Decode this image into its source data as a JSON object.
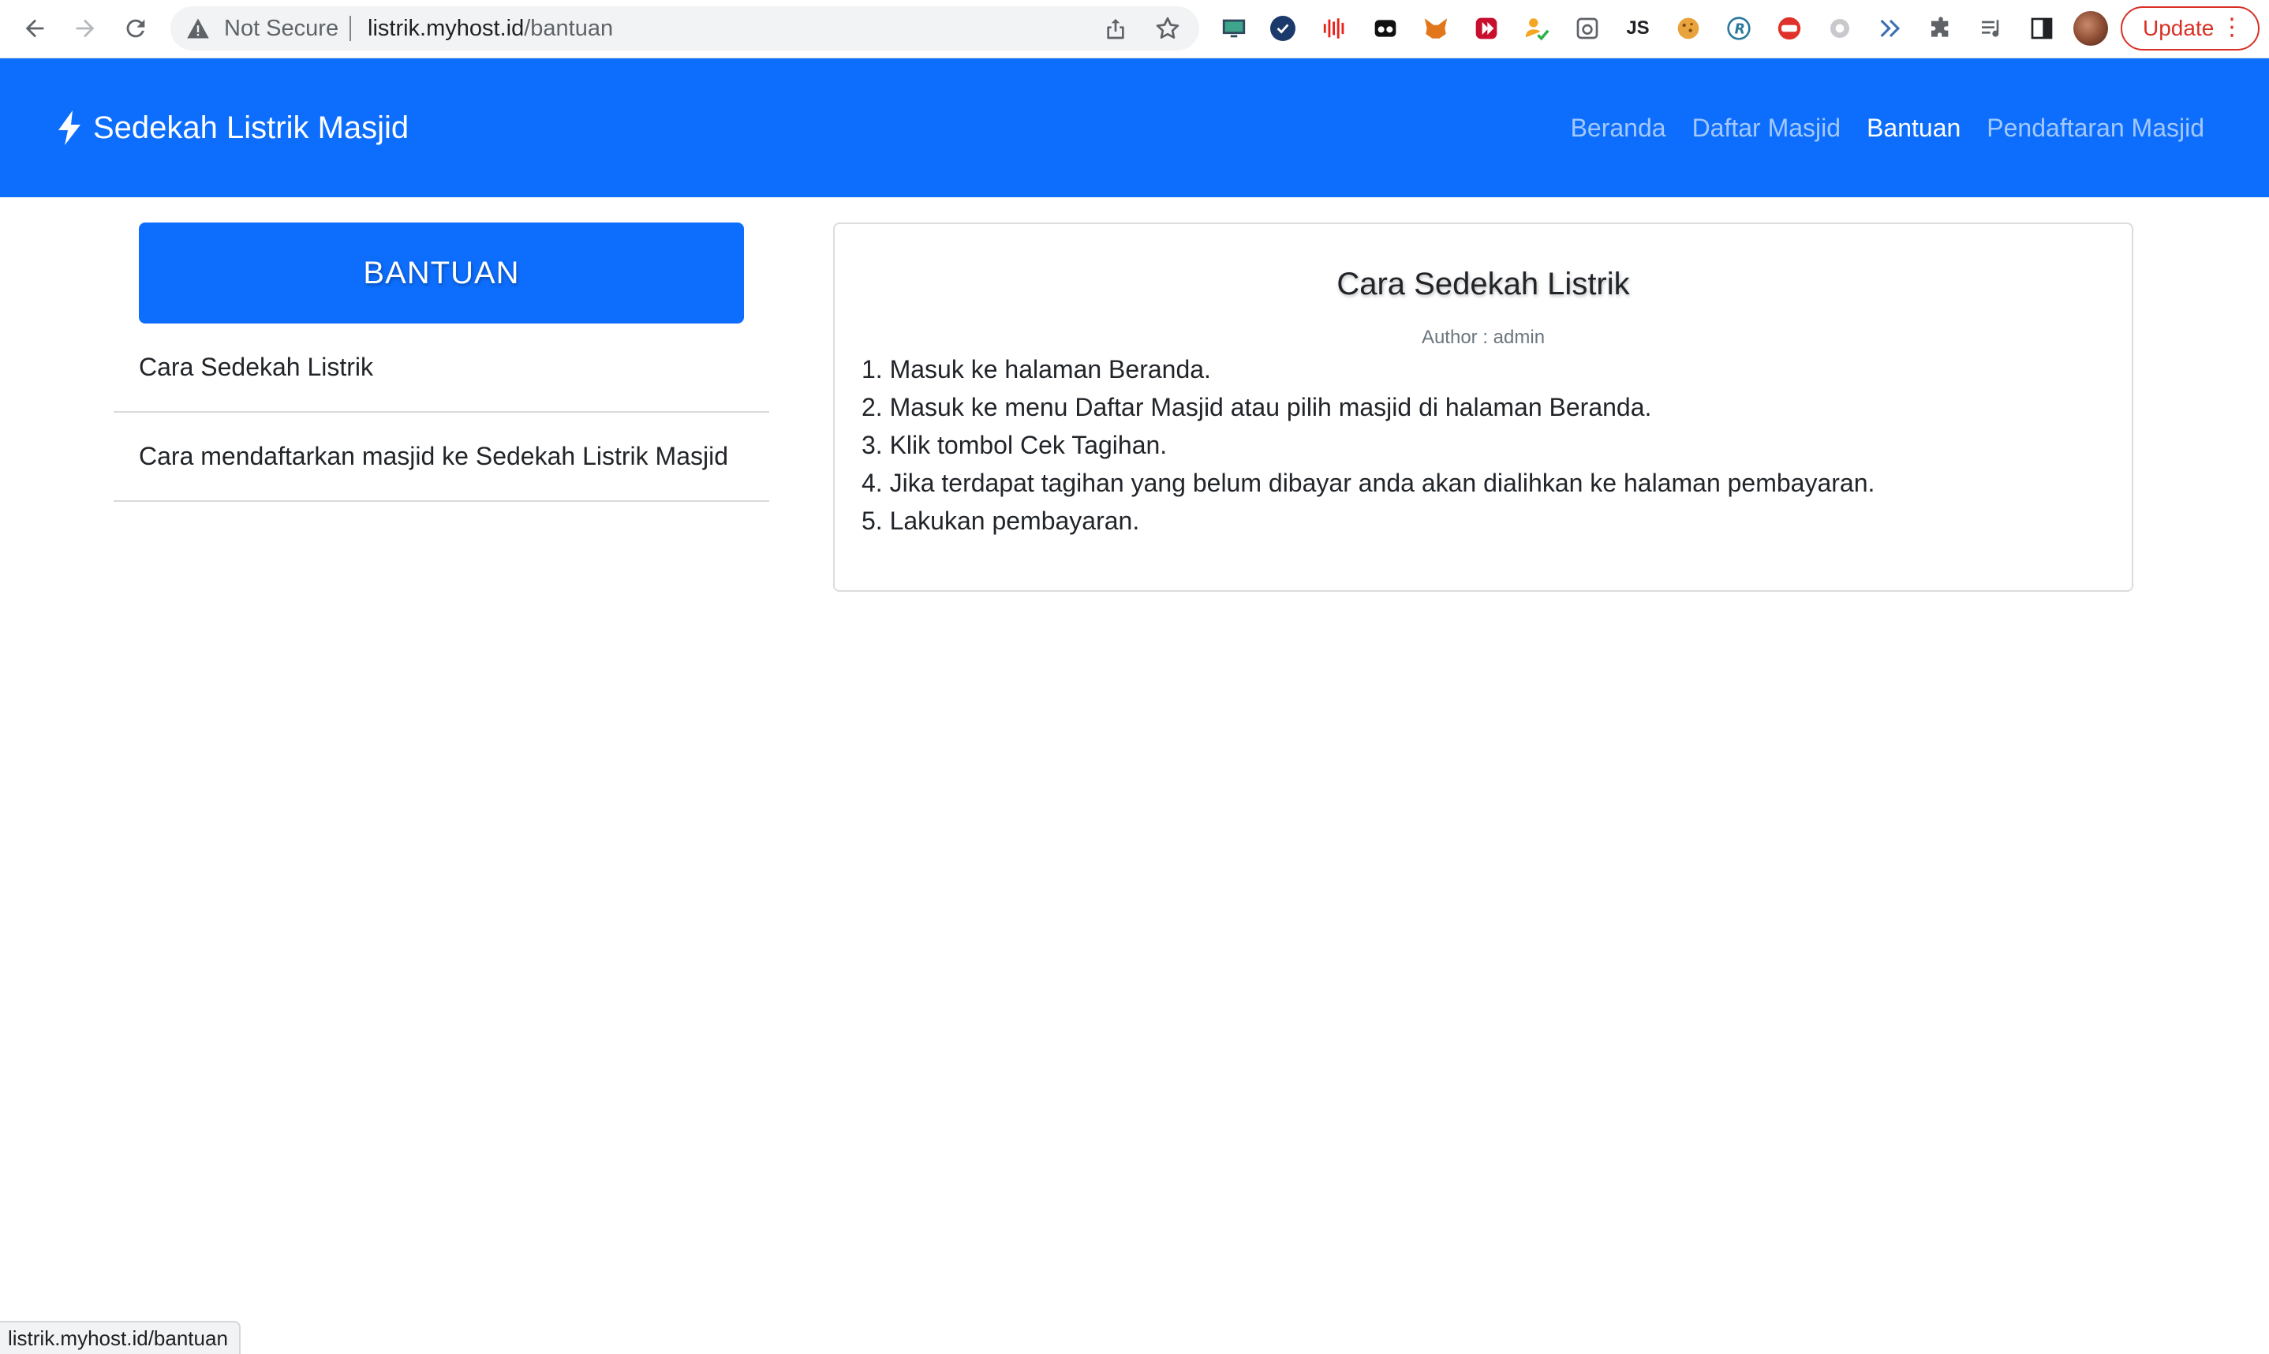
{
  "browser": {
    "security_label": "Not Secure",
    "url_host": "listrik.myhost.id",
    "url_path": "/bantuan",
    "update_label": "Update",
    "extensions": [
      "monitor-icon",
      "check-circle-icon",
      "audio-wave-icon",
      "mask-icon",
      "fox-icon",
      "play-square-icon",
      "person-check-icon",
      "camera-icon",
      "js-icon",
      "cookie-icon",
      "r-icon",
      "code-icon",
      "gear-icon",
      "arrow-icon",
      "puzzle-icon",
      "playlist-icon",
      "sidepanel-icon"
    ],
    "js_ext_label": "JS",
    "status_url": "listrik.myhost.id/bantuan"
  },
  "navbar": {
    "brand": "Sedekah Listrik Masjid",
    "links": [
      {
        "label": "Beranda",
        "active": false
      },
      {
        "label": "Daftar Masjid",
        "active": false
      },
      {
        "label": "Bantuan",
        "active": true
      },
      {
        "label": "Pendaftaran Masjid",
        "active": false
      }
    ],
    "color": "#0d6efd"
  },
  "sidebar": {
    "header": "BANTUAN",
    "items": [
      {
        "label": "Cara Sedekah Listrik"
      },
      {
        "label": "Cara mendaftarkan masjid ke Sedekah Listrik Masjid"
      }
    ]
  },
  "article": {
    "title": "Cara Sedekah Listrik",
    "author": "Author : admin",
    "steps": [
      "1. Masuk ke halaman Beranda.",
      "2. Masuk ke menu Daftar Masjid atau pilih masjid di halaman Beranda.",
      "3. Klik tombol Cek Tagihan.",
      "4. Jika terdapat tagihan yang belum dibayar anda akan dialihkan ke halaman pembayaran.",
      "5. Lakukan pembayaran."
    ]
  }
}
